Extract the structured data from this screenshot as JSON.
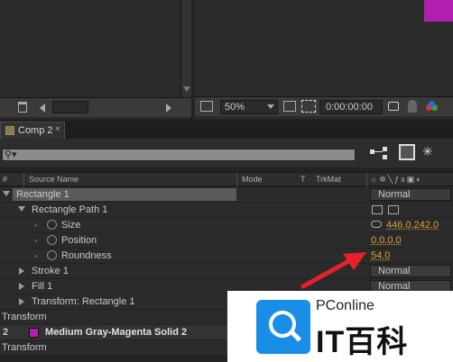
{
  "viewer": {
    "zoom": "50%",
    "timecode": "0:00:00:00"
  },
  "comp_tab": {
    "label": "Comp 2",
    "close": "×"
  },
  "columns": {
    "num": "#",
    "source_name": "Source Name",
    "mode": "Mode",
    "t": "T",
    "trkmat": "TrkMat"
  },
  "rows": [
    {
      "label": "Rectangle 1",
      "mode": "Normal"
    },
    {
      "label": "Rectangle Path 1"
    },
    {
      "label": "Size",
      "value": "446.0,242.0"
    },
    {
      "label": "Position",
      "value": "0.0,0.0"
    },
    {
      "label": "Roundness",
      "value": "54.0"
    },
    {
      "label": "Stroke 1",
      "mode": "Normal"
    },
    {
      "label": "Fill 1",
      "mode": "Normal"
    },
    {
      "label": "Transform: Rectangle 1"
    },
    {
      "label": "Transform"
    },
    {
      "num": "2",
      "label": "Medium Gray-Magenta Solid 2"
    },
    {
      "label": "Transform"
    }
  ],
  "watermark": {
    "brand": "PConline",
    "text": "IT百科"
  },
  "colors": {
    "value": "#d8a33c",
    "solid_swatch": "#b01fb0",
    "arrow": "#e8202a"
  }
}
